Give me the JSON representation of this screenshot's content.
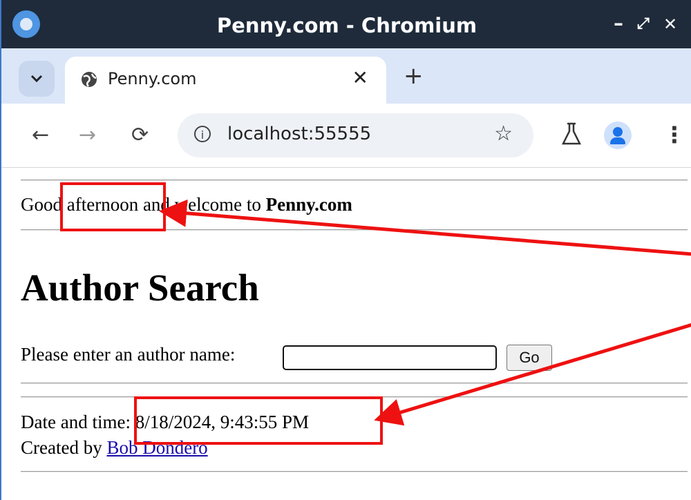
{
  "window": {
    "title": "Penny.com - Chromium",
    "controls": [
      "–",
      "⤢",
      "✕"
    ]
  },
  "tabs": [
    {
      "title": "Penny.com",
      "active": true
    }
  ],
  "toolbar": {
    "url": "localhost:55555"
  },
  "page": {
    "greeting_prefix": "Good afternoon and welcome to ",
    "site_name": "Penny.com",
    "heading": "Author Search",
    "prompt_label": "Please enter an author name:",
    "author_input_value": "",
    "go_label": "Go",
    "datetime_label": "Date and time: ",
    "datetime_value": "8/18/2024, 9:43:55 PM",
    "created_label": "Created by ",
    "author_link": "Bob Dondero"
  },
  "annotations": {
    "color": "#ee1111"
  },
  "icons": [
    "app-icon",
    "chevron-down-icon",
    "globe-icon",
    "close-icon",
    "plus-icon",
    "back-icon",
    "forward-icon",
    "reload-icon",
    "info-icon",
    "star-icon",
    "flask-icon",
    "profile-icon",
    "menu-icon"
  ]
}
